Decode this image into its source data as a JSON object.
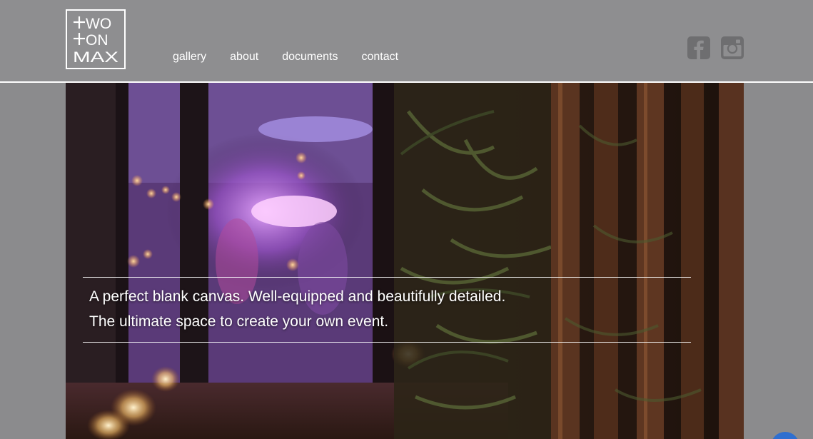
{
  "logo": {
    "lines": [
      "WO",
      "ON",
      "MAX"
    ],
    "icon": "two-on-max-logo"
  },
  "nav": {
    "items": [
      {
        "label": "gallery"
      },
      {
        "label": "about"
      },
      {
        "label": "documents"
      },
      {
        "label": "contact"
      }
    ]
  },
  "social": {
    "facebook_icon": "facebook-icon",
    "instagram_icon": "instagram-icon"
  },
  "hero": {
    "tagline_line1": "A perfect blank canvas. Well-equipped and beautifully detailed.",
    "tagline_line2": "The ultimate space to create your own event."
  },
  "colors": {
    "header_bg": "#8e8e90",
    "page_bg": "#8b8b8d",
    "icon_gray": "#6e6e70",
    "text": "#ffffff"
  }
}
